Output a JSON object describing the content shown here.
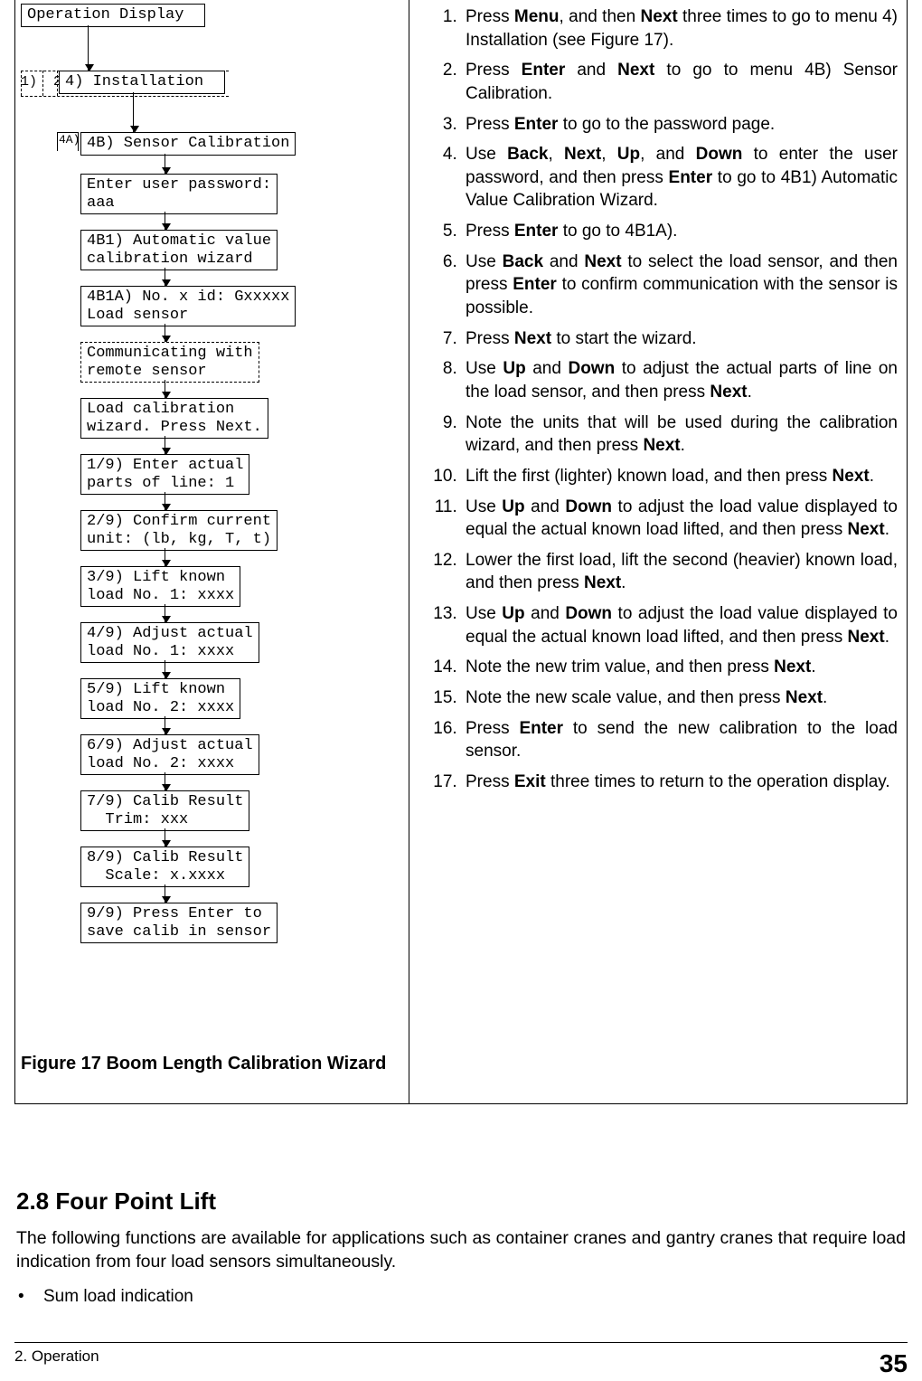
{
  "flow": {
    "op_display": "Operation Display",
    "tabs": "1)  2)  3)",
    "installation": "4) Installation",
    "tab4a": "4A)",
    "b4b": "4B) Sensor Calibration",
    "pwd": "Enter user password:\naaa",
    "b4b1": "4B1) Automatic value\ncalibration wizard",
    "b4b1a": "4B1A) No. x id: Gxxxxx\nLoad sensor",
    "comm": "Communicating with\nremote sensor",
    "loadwiz": "Load calibration\nwizard. Press Next.",
    "s1": "1/9) Enter actual\nparts of line: 1",
    "s2": "2/9) Confirm current\nunit: (lb, kg, T, t)",
    "s3": "3/9) Lift known\nload No. 1: xxxx",
    "s4": "4/9) Adjust actual\nload No. 1: xxxx",
    "s5": "5/9) Lift known\nload No. 2: xxxx",
    "s6": "6/9) Adjust actual\nload No. 2: xxxx",
    "s7": "7/9) Calib Result\n  Trim: xxx",
    "s8": "8/9) Calib Result\n  Scale: x.xxxx",
    "s9": "9/9) Press Enter to\nsave calib in sensor"
  },
  "caption": "Figure 17  Boom Length Calibration Wizard",
  "steps": [
    "Press <b>Menu</b>, and then <b>Next</b> three times to go to menu 4) Installation (see Figure 17).",
    "Press <b>Enter</b> and <b>Next</b> to go to menu 4B) Sensor Calibration.",
    "Press <b>Enter</b> to go to the password page.",
    "Use <b>Back</b>, <b>Next</b>, <b>Up</b>, and <b>Down</b> to enter the user password, and then press <b>Enter</b> to go to 4B1) Automatic Value Calibration Wizard.",
    "Press <b>Enter</b> to go to 4B1A).",
    "Use <b>Back</b> and <b>Next</b> to select the load sensor, and then press <b>Enter</b> to confirm communication with the sensor is possible.",
    "Press <b>Next</b> to start the wizard.",
    "Use <b>Up</b> and <b>Down</b> to adjust the actual parts of line on the load sensor, and then press <b>Next</b>.",
    "Note the units that will be used during the calibration wizard, and then press <b>Next</b>.",
    "Lift the first (lighter) known load, and then press <b>Next</b>.",
    "Use <b>Up</b> and <b>Down</b> to adjust the load value displayed to equal the actual known load lifted, and then press <b>Next</b>.",
    "Lower the first load, lift the second (heavier) known load, and then press <b>Next</b>.",
    "Use <b>Up</b> and <b>Down</b> to adjust the load value displayed to equal the actual known load lifted, and then press <b>Next</b>.",
    "Note the new trim value, and then press <b>Next</b>.",
    "Note the new scale value, and then press <b>Next</b>.",
    "Press <b>Enter</b> to send the new calibration to the load sensor.",
    "Press <b>Exit</b> three times to return to the operation display."
  ],
  "section": {
    "heading": "2.8 Four Point Lift",
    "para": "The following functions are available for applications such as container cranes and gantry cranes that require load indication from four load sensors simultaneously.",
    "bullet1": "Sum load indication"
  },
  "footer": {
    "left": "2. Operation",
    "page": "35"
  }
}
